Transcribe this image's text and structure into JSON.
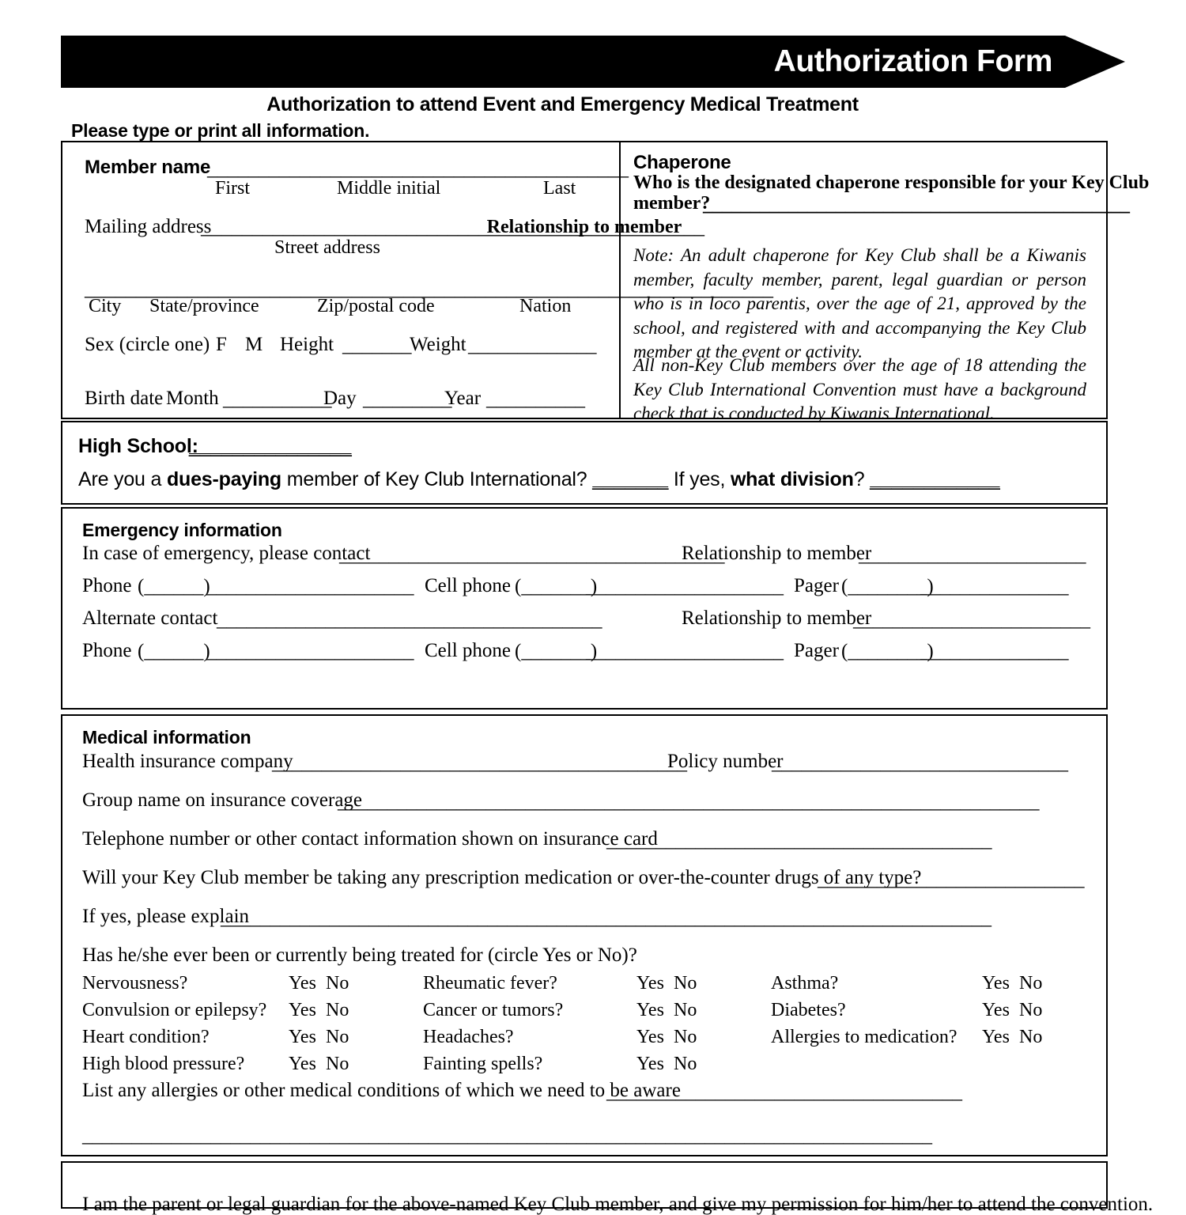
{
  "header": {
    "banner_title": "Authorization Form",
    "subtitle": "Authorization to attend Event and Emergency Medical Treatment",
    "instruction": "Please type or print all information."
  },
  "member": {
    "name_label": "Member name",
    "name_blank": "_________________________________________",
    "caption_first": "First",
    "caption_middle": "Middle initial",
    "caption_last": "Last",
    "mailing_label": "Mailing address",
    "mailing_blank": "_________________________________________________",
    "caption_street": "Street address",
    "address2_blank": "___________________________________________________________________",
    "caption_city": "City",
    "caption_state": "State/province",
    "caption_zip": "Zip/postal code",
    "caption_nation": "Nation",
    "sex_label": "Sex (circle one)",
    "sex_f": "F",
    "sex_m": "M",
    "height_label": "Height",
    "height_blank": "_______",
    "weight_label": "Weight",
    "weight_blank": "_____________",
    "birth_label": "Birth date",
    "month_label": "Month",
    "month_blank": "___________",
    "day_label": "Day",
    "day_blank": "_________",
    "year_label": "Year",
    "year_blank": "__________"
  },
  "chaperone": {
    "heading": "Chaperone",
    "question": "Who is the designated chaperone responsible for your Key Club",
    "question_line2": "member?",
    "question_blank": "_____________________________________________",
    "relationship_caption": "Relationship to member",
    "note": "Note:  An adult chaperone for Key Club shall be a Kiwanis member, faculty member, parent, legal guardian or person who is in loco parentis, over the age of 21, approved by the school, and registered with and accompanying the Key Club member at the event or activity.",
    "note2": "All non-Key Club members over the age of 18 attending the Key Club International Convention must have a background check that is conducted by Kiwanis International."
  },
  "school": {
    "label": "High School:",
    "blank": "_______________",
    "dues_part1": "Are you a ",
    "dues_bold1": "dues-paying",
    "dues_part2": " member of Key Club International? ",
    "dues_blank1": "_______",
    "dues_part3": " If yes, ",
    "dues_bold2": "what division",
    "dues_part4": "? ",
    "dues_blank2": "____________"
  },
  "emergency": {
    "heading": "Emergency information",
    "contact_label": "In case of emergency, please contact",
    "contact_blank": "_______________________________________",
    "relationship_label": "Relationship to member",
    "relationship_blank": "_______________________",
    "phone_label": "Phone",
    "phone_paren": "(______)",
    "phone_blank": "_____________________",
    "cell_label": "Cell phone",
    "cell_paren": "(_______)",
    "cell_blank": "____________________",
    "pager_label": "Pager",
    "pager_paren": "(________)",
    "pager_blank": "_______________",
    "alternate_label": "Alternate contact",
    "alternate_blank": "_______________________________________",
    "alt_relationship_label": "Relationship to member",
    "alt_relationship_blank": "________________________"
  },
  "medical": {
    "heading": "Medical information",
    "insurance_label": "Health insurance company",
    "insurance_blank": "__________________________________________",
    "policy_label": "Policy number",
    "policy_blank": "______________________________",
    "group_label": "Group name on insurance coverage",
    "group_blank": "_______________________________________________________________________",
    "telephone_label": "Telephone number or other contact information shown on insurance card",
    "telephone_blank": "_______________________________________",
    "prescription_label": "Will your Key Club member be taking any prescription medication or over-the-counter drugs of any type?",
    "prescription_blank": "___________________________",
    "explain_label": "If yes, please explain",
    "explain_blank": "______________________________________________________________________________",
    "conditions_prompt": "Has he/she ever been or currently being treated for (circle Yes or No)?",
    "yes": "Yes",
    "no": "No",
    "conditions_col1": [
      "Nervousness?",
      "Convulsion or epilepsy?",
      "Heart condition?",
      "High blood pressure?"
    ],
    "conditions_col2": [
      "Rheumatic fever?",
      "Cancer or tumors?",
      "Headaches?",
      "Fainting spells?"
    ],
    "conditions_col3": [
      "Asthma?",
      "Diabetes?",
      "Allergies to medication?"
    ],
    "allergies_label": "List any allergies or other medical conditions of which we need to be aware",
    "allergies_blank": "____________________________________",
    "allergies_blank2": "______________________________________________________________________________________"
  },
  "consent": {
    "text": "I am the parent or legal guardian for the above-named Key Club member, and give my permission for him/her to attend the convention."
  }
}
